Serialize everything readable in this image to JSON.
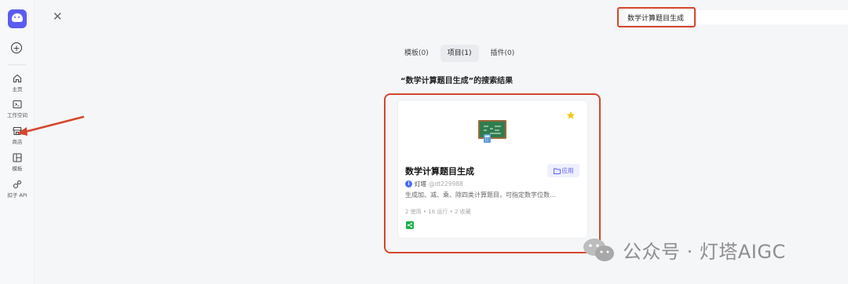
{
  "sidebar": {
    "items": [
      {
        "label": "主页",
        "icon": "home-icon"
      },
      {
        "label": "工作空间",
        "icon": "terminal-icon"
      },
      {
        "label": "商店",
        "icon": "store-icon"
      },
      {
        "label": "模板",
        "icon": "template-icon"
      },
      {
        "label": "扣子 API",
        "icon": "api-icon"
      }
    ]
  },
  "search": {
    "value": "数学计算题目生成"
  },
  "tabs": [
    {
      "label": "模板(0)"
    },
    {
      "label": "项目(1)"
    },
    {
      "label": "插件(0)"
    }
  ],
  "results_heading": "“数学计算题目生成”的搜索结果",
  "card": {
    "title": "数学计算题目生成",
    "badge": "应用",
    "author_name": "灯塔",
    "author_handle": "@dt229988",
    "description": "生成加、减、乘、除四类计算题目，可指定数字位数…",
    "stats": "2 使用 • 16 运行 • 2 收藏"
  },
  "watermark": {
    "text": "公众号 · 灯塔AIGC"
  },
  "colors": {
    "accent": "#5a5cf0",
    "highlight": "#d5462b",
    "share": "#19b34a"
  }
}
